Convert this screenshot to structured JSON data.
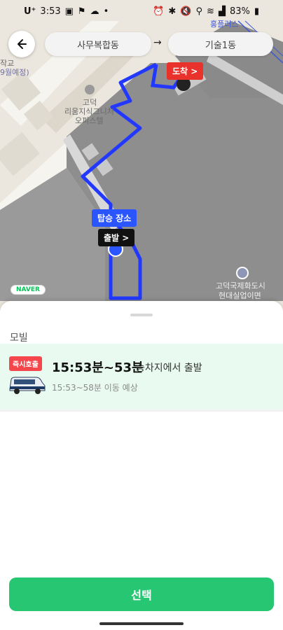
{
  "status_bar": {
    "carrier": "U⁺",
    "time": "3:53",
    "battery": "83%"
  },
  "route": {
    "from": "사무복합동",
    "arrow": "→",
    "to": "기술1동"
  },
  "map": {
    "arrive_tag": "도착 >",
    "board_tag": "탑승 장소",
    "depart_tag": "출발 >",
    "labels": {
      "top_right": "홍플러스",
      "left_top_1": "작교",
      "left_top_2": "9월예정)",
      "poi_1": "고덕",
      "poi_2": "리움지식그니처",
      "poi_3": "오피스텔",
      "poi_3b": "고덕",
      "bottom_right_1": "고덕국제화도시",
      "bottom_right_2": "현대실업이면"
    },
    "logo": "NAVER"
  },
  "sheet": {
    "section": "모빌",
    "option": {
      "badge": "즉시호출",
      "time_range": "15:53분~53분",
      "time_note": "승차지에서 출발",
      "eta": "15:53~58분 이동 예상"
    },
    "select_button": "선택"
  },
  "colors": {
    "route_line": "#2238ff",
    "arrive_tag": "#e8322b",
    "board_tag": "#2a55ff",
    "select_button": "#27c673",
    "option_bg": "#e9fbf1",
    "badge": "#f4464b"
  }
}
